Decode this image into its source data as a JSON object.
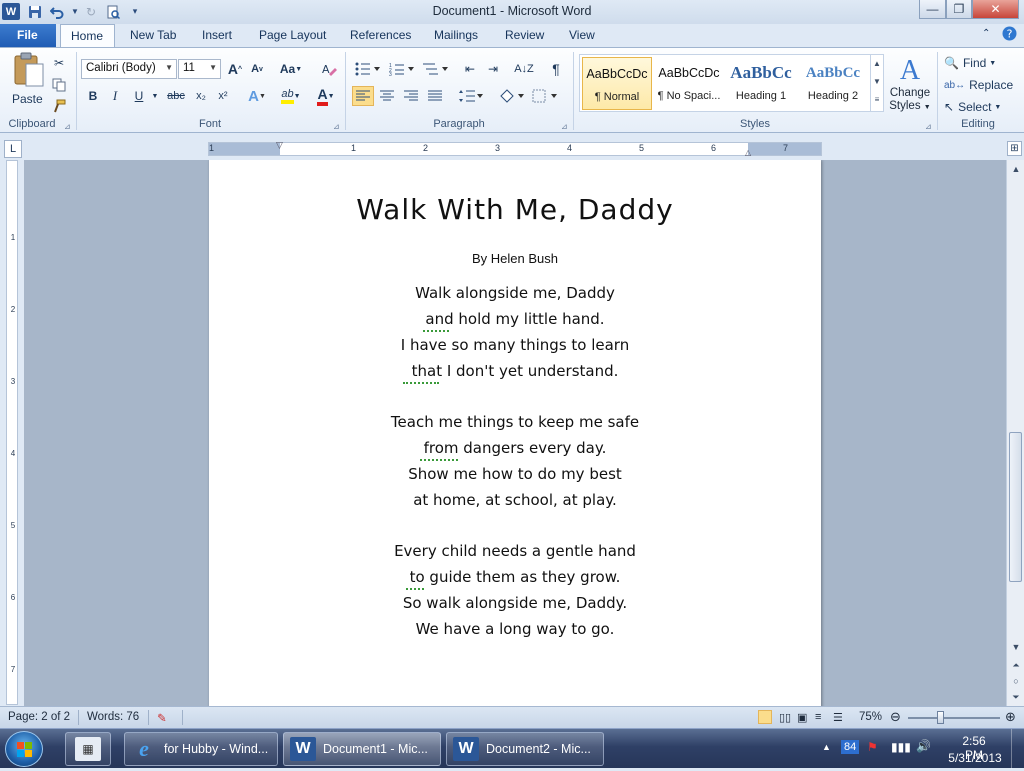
{
  "window": {
    "title": "Document1  -  Microsoft Word",
    "app_icon_letter": "W",
    "minimize_glyph": "—",
    "maximize_glyph": "❐",
    "close_glyph": "✕"
  },
  "ribbon_tabs": [
    "File",
    "Home",
    "New Tab",
    "Insert",
    "Page Layout",
    "References",
    "Mailings",
    "Review",
    "View"
  ],
  "active_tab": "Home",
  "clipboard": {
    "paste_label": "Paste",
    "group_label": "Clipboard"
  },
  "font": {
    "family": "Calibri (Body)",
    "size": "11",
    "group_label": "Font",
    "grow": "A",
    "shrink": "A",
    "change_case": "Aa",
    "bold": "B",
    "italic": "I",
    "underline": "U",
    "strike": "abc",
    "subscript": "x₂",
    "superscript": "x²",
    "text_effects": "A",
    "highlight": "ab",
    "font_color": "A"
  },
  "paragraph": {
    "group_label": "Paragraph",
    "show_marks": "¶"
  },
  "styles": {
    "group_label": "Styles",
    "items": [
      {
        "sample": "AaBbCcDc",
        "name": "¶ Normal"
      },
      {
        "sample": "AaBbCcDc",
        "name": "¶ No Spaci..."
      },
      {
        "sample": "AaBbCc",
        "name": "Heading 1"
      },
      {
        "sample": "AaBbCc",
        "name": "Heading 2"
      }
    ],
    "change_styles": "Change Styles",
    "change_styles_line1": "Change",
    "change_styles_line2": "Styles"
  },
  "editing": {
    "group_label": "Editing",
    "find": "Find",
    "replace": "Replace",
    "select": "Select"
  },
  "ruler": {
    "numbers": [
      "1",
      "1",
      "2",
      "3",
      "4",
      "5",
      "6",
      "7"
    ],
    "vnumbers": [
      "1",
      "2",
      "3",
      "4",
      "5",
      "6",
      "7"
    ]
  },
  "document": {
    "title": "Walk With Me, Daddy",
    "byline": "By Helen Bush",
    "lines": [
      "Walk alongside me, Daddy",
      "and hold my little hand.",
      "I have so many things to learn",
      "that I don't yet understand.",
      "Teach me things to keep me safe",
      "from dangers every day.",
      "Show me how to do my best",
      "at home, at school, at play.",
      "Every child needs a gentle hand",
      "to guide them as they grow.",
      "So walk alongside me, Daddy.",
      "We have a long way to go."
    ]
  },
  "statusbar": {
    "page": "Page: 2 of 2",
    "words": "Words: 76",
    "zoom": "75%"
  },
  "taskbar": {
    "items": [
      {
        "label": "for Hubby - Wind..."
      },
      {
        "label": "Document1 - Mic..."
      },
      {
        "label": "Document2 - Mic..."
      }
    ],
    "tray_badge": "84",
    "time": "2:56 PM",
    "date": "5/31/2013"
  }
}
